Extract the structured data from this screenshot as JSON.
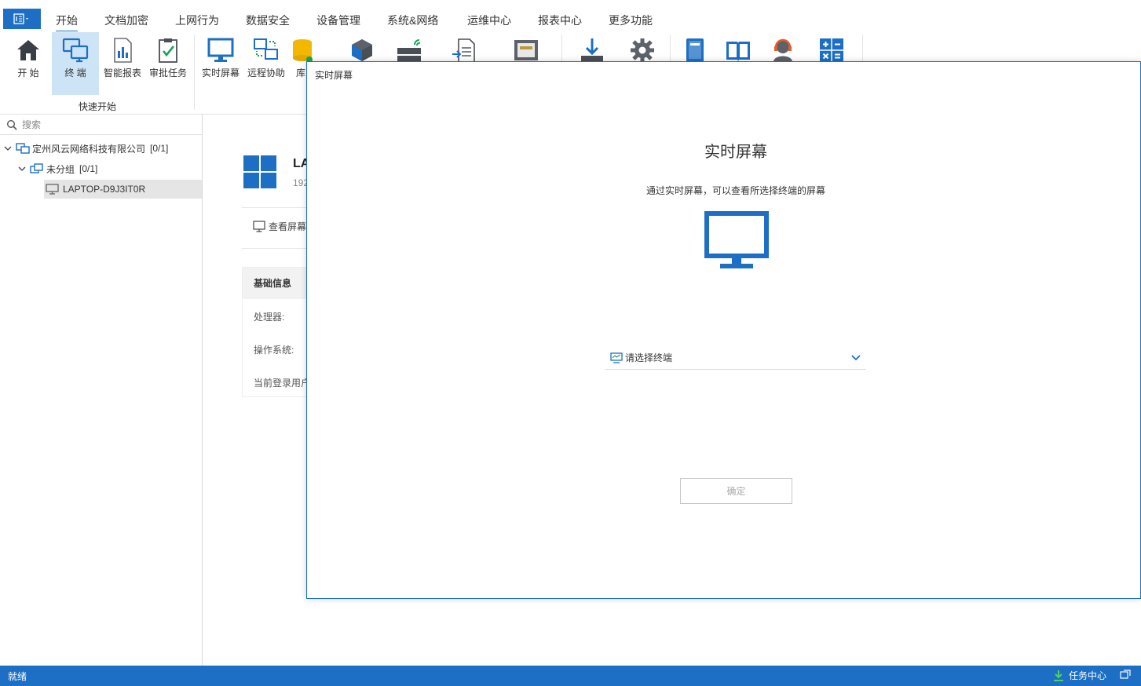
{
  "menu": {
    "app_icon": "app-menu-icon",
    "tabs": [
      "开始",
      "文档加密",
      "上网行为",
      "数据安全",
      "设备管理",
      "系统&网络",
      "运维中心",
      "报表中心",
      "更多功能"
    ],
    "active_tab": "开始"
  },
  "ribbon": {
    "buttons": [
      {
        "label": "开 始",
        "icon": "home-icon"
      },
      {
        "label": "终 端",
        "icon": "terminal-icon"
      },
      {
        "label": "智能报表",
        "icon": "report-icon"
      },
      {
        "label": "审批任务",
        "icon": "approval-icon"
      },
      {
        "label": "实时屏幕",
        "icon": "monitor-icon"
      },
      {
        "label": "远程协助",
        "icon": "remote-icon"
      },
      {
        "label": "库",
        "icon": "database-icon"
      },
      {
        "label": "",
        "icon": "cube-icon"
      },
      {
        "label": "",
        "icon": "network-device-icon"
      },
      {
        "label": "",
        "icon": "document-transfer-icon"
      },
      {
        "label": "",
        "icon": "storage-icon"
      },
      {
        "label": "",
        "icon": "download-icon"
      },
      {
        "label": "",
        "icon": "gear-icon"
      },
      {
        "label": "",
        "icon": "manual-icon"
      },
      {
        "label": "",
        "icon": "book-icon"
      },
      {
        "label": "",
        "icon": "support-icon"
      },
      {
        "label": "",
        "icon": "calculator-icon"
      }
    ],
    "group_label": "快速开始"
  },
  "left_panel": {
    "search_placeholder": "搜索",
    "tree": [
      {
        "label": "定州风云网络科技有限公司",
        "count": "[0/1]"
      },
      {
        "label": "未分组",
        "count": "[0/1]"
      },
      {
        "label": "LAPTOP-D9J3IT0R"
      }
    ]
  },
  "detail": {
    "host_title": "LA",
    "host_ip": "192",
    "view_screen": "查看屏幕",
    "basic_info_title": "基础信息",
    "rows": [
      "处理器:",
      "操作系统:",
      "当前登录用户"
    ]
  },
  "dialog": {
    "title": "实时屏幕",
    "heading": "实时屏幕",
    "description": "通过实时屏幕，可以查看所选择终端的屏幕",
    "select_placeholder": "请选择终端",
    "confirm": "确定",
    "accent": "#1c6fc4"
  },
  "status": {
    "text": "就绪",
    "task_center": "任务中心"
  }
}
